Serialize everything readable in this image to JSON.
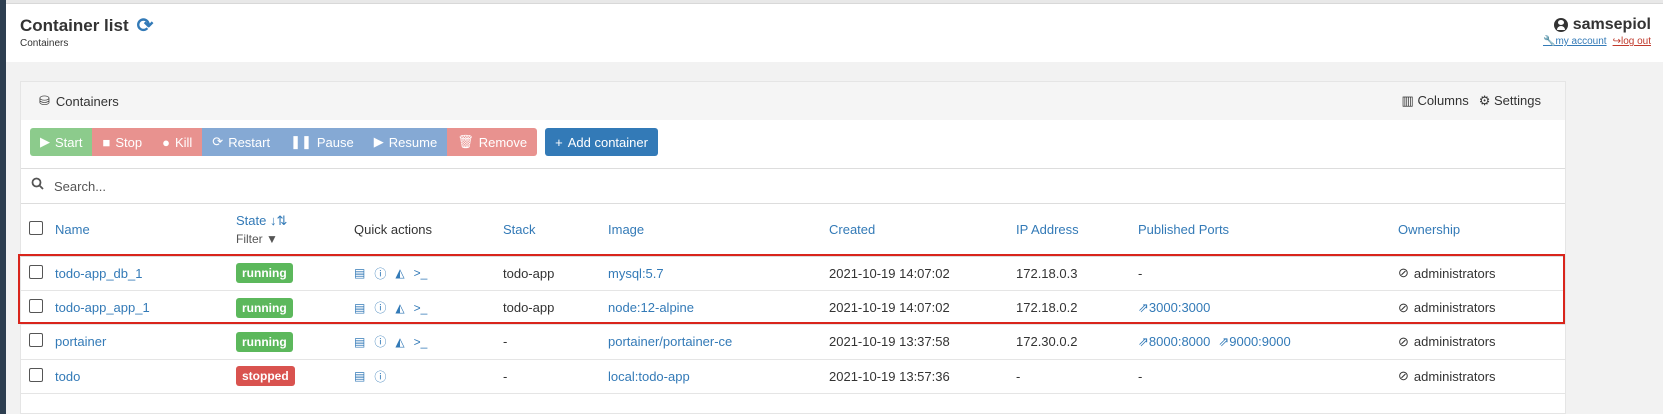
{
  "header": {
    "title": "Container list",
    "subtitle": "Containers",
    "username": "samsepiol",
    "my_account": "my account",
    "log_out": "log out"
  },
  "panel": {
    "title": "Containers",
    "columns_label": "Columns",
    "settings_label": "Settings"
  },
  "actions": {
    "start": "Start",
    "stop": "Stop",
    "kill": "Kill",
    "restart": "Restart",
    "pause": "Pause",
    "resume": "Resume",
    "remove": "Remove",
    "add": "Add container"
  },
  "search": {
    "placeholder": "Search..."
  },
  "table": {
    "headers": {
      "name": "Name",
      "state": "State",
      "filter": "Filter",
      "quick_actions": "Quick actions",
      "stack": "Stack",
      "image": "Image",
      "created": "Created",
      "ip": "IP Address",
      "ports": "Published Ports",
      "ownership": "Ownership"
    },
    "rows": [
      {
        "name": "todo-app_db_1",
        "state": "running",
        "stack": "todo-app",
        "image": "mysql:5.7",
        "created": "2021-10-19 14:07:02",
        "ip": "172.18.0.3",
        "ports": [
          "-"
        ],
        "ownership": "administrators"
      },
      {
        "name": "todo-app_app_1",
        "state": "running",
        "stack": "todo-app",
        "image": "node:12-alpine",
        "created": "2021-10-19 14:07:02",
        "ip": "172.18.0.2",
        "ports": [
          "3000:3000"
        ],
        "ownership": "administrators"
      },
      {
        "name": "portainer",
        "state": "running",
        "stack": "-",
        "image": "portainer/portainer-ce",
        "created": "2021-10-19 13:37:58",
        "ip": "172.30.0.2",
        "ports": [
          "8000:8000",
          "9000:9000"
        ],
        "ownership": "administrators"
      },
      {
        "name": "todo",
        "state": "stopped",
        "stack": "-",
        "image": "local:todo-app",
        "created": "2021-10-19 13:57:36",
        "ip": "-",
        "ports": [
          "-"
        ],
        "ownership": "administrators"
      }
    ]
  },
  "icons": {
    "refresh": "refresh-icon",
    "user": "user-icon",
    "containers": "cubes-icon",
    "columns": "columns-icon",
    "settings": "gear-icon",
    "search": "search-icon",
    "logs": "file-icon",
    "inspect": "info-icon",
    "stats": "chart-icon",
    "console": "terminal-icon",
    "port": "external-link-icon",
    "ownership": "eye-slash-icon"
  },
  "colors": {
    "primary": "#337ab7",
    "running": "#5cb85c",
    "stopped": "#d9534f",
    "highlight": "#d9251c"
  }
}
